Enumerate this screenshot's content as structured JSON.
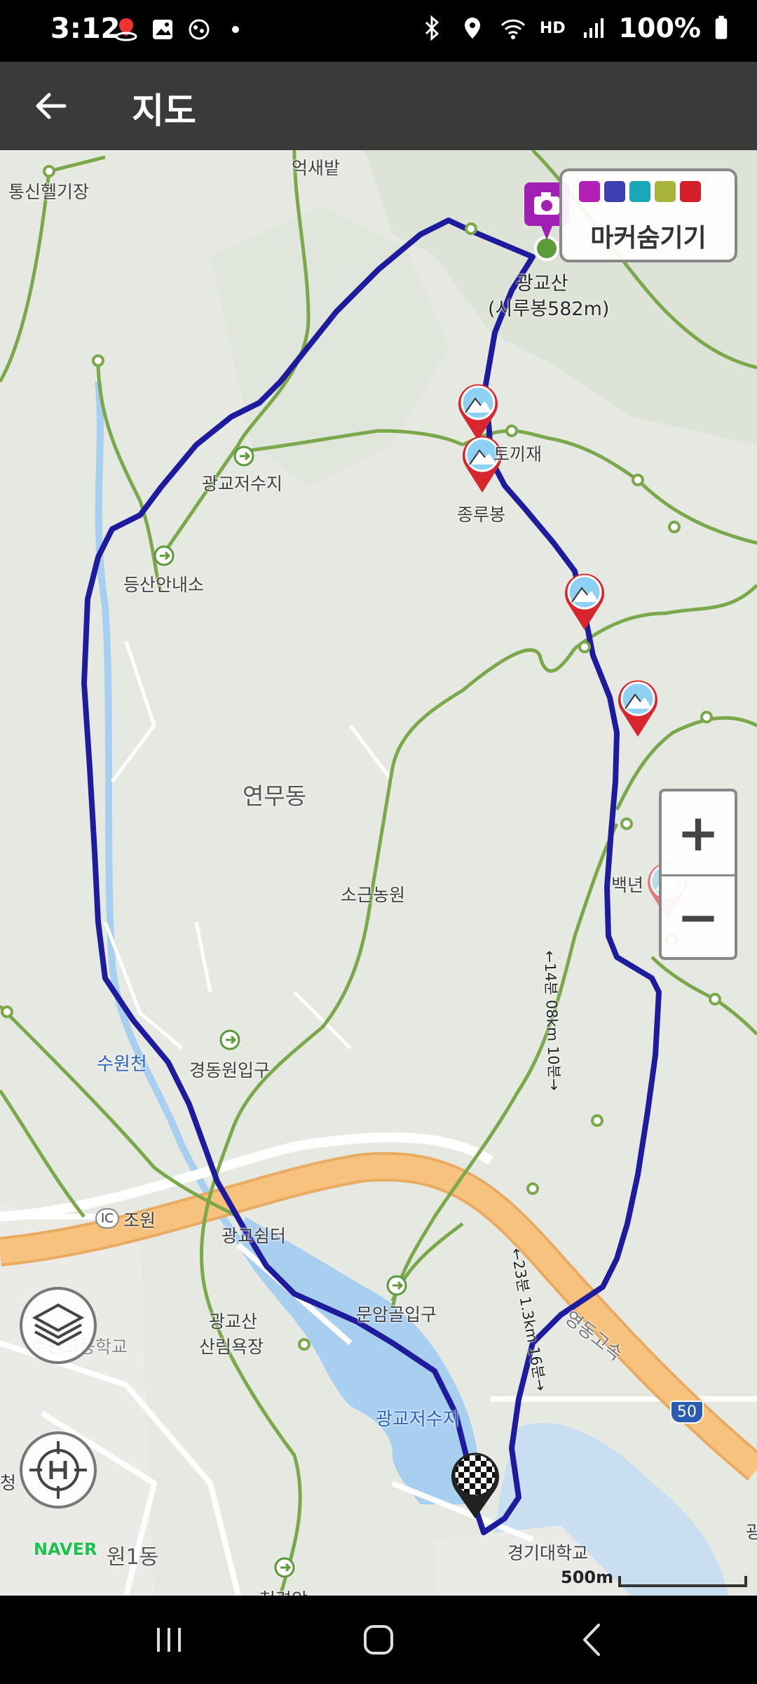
{
  "status_bar": {
    "time": "3:12",
    "battery": "100%",
    "icons_left": [
      "location-notification-icon",
      "gallery-icon",
      "fitness-app-icon",
      "dot-icon"
    ],
    "icons_right": [
      "bluetooth-icon",
      "location-icon",
      "wifi-icon",
      "hd-voice-icon",
      "signal-icon",
      "battery-icon"
    ],
    "hd_voice": "HD"
  },
  "app_bar": {
    "title": "지도",
    "back_icon": "arrow-left-icon"
  },
  "map": {
    "labels": {
      "tongsin": "통신헬기장",
      "eoksaebat": "억새밭",
      "gwanggyosan": "광교산",
      "sirubong": "(시루봉582m)",
      "tokkijae": "토끼재",
      "jongrubong": "종루봉",
      "gwanggyo_reservoir_top": "광교저수지",
      "trail_office": "등산안내소",
      "yeonmudong": "연무동",
      "sogeun_farm": "소근농원",
      "baeknyeon": "백년",
      "suwoncheon": "수원천",
      "gyeongdong_entrance": "경동원입구",
      "ic": "IC",
      "jowon": "조원",
      "gwanggyo_shelter": "광교쉼터",
      "munamgol": "문암골입구",
      "school": "수원고등학교",
      "forest_bath": "광교산\n산림욕장",
      "gwanggyo_reservoir": "광교저수지",
      "yeongdong_expressway": "영동고속",
      "route50": "50",
      "kyonggi_univ": "경기대학교",
      "won1dong": "원1동",
      "cheongryeonam": "청련암",
      "cheong": "청",
      "gong_edge": "광",
      "segment_top": "←14분 08km 10분→",
      "segment_bottom": "←23분 1.3km 16분→"
    },
    "marker_hide": {
      "label": "마커숨기기",
      "icon_colors": [
        "#b320b5",
        "#3b3fb0",
        "#1aa7b8",
        "#a7b33a",
        "#d21f2a"
      ],
      "icons": [
        "camera-icon",
        "video-icon",
        "pin-icon",
        "note-icon",
        "flag-icon"
      ]
    },
    "zoom": {
      "in": "+",
      "out": "−"
    },
    "layers_icon": "layers-icon",
    "gps_icon": "gps-h-icon",
    "naver_logo": "NAVER",
    "scale": "500m",
    "route_color": "#1e1b9c",
    "trail_color": "#7aa84a",
    "highway_color": "#f7c27e",
    "water_color": "#a9cff0",
    "photo_marker_color": "#a21fb3"
  },
  "nav_bar": {
    "icons": [
      "recent-apps-icon",
      "home-icon",
      "back-icon"
    ]
  }
}
